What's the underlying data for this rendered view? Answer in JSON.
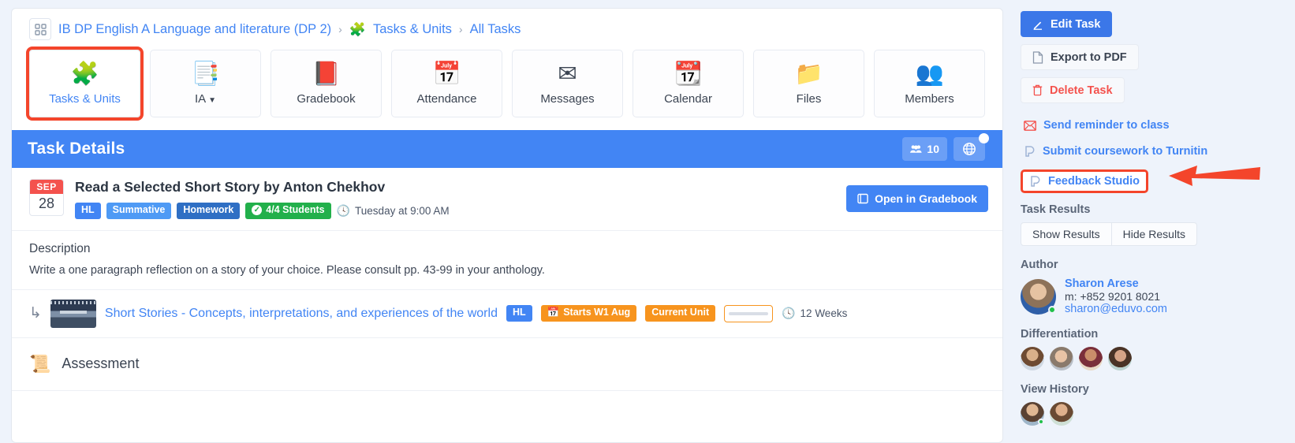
{
  "breadcrumb": {
    "grid_icon": "grid-icon",
    "course": "IB DP English A Language and literature (DP 2)",
    "sep1": "›",
    "section_icon": "puzzle-icon",
    "section": "Tasks & Units",
    "sep2": "›",
    "current": "All Tasks"
  },
  "tabs": [
    {
      "label": "Tasks & Units",
      "icon": "🧩",
      "icon_name": "puzzle-icon",
      "active": true
    },
    {
      "label": "IA",
      "icon": "📑",
      "icon_name": "documents-icon",
      "active": false,
      "caret": "▼"
    },
    {
      "label": "Gradebook",
      "icon": "📕",
      "icon_name": "gradebook-icon",
      "active": false
    },
    {
      "label": "Attendance",
      "icon": "📅",
      "icon_name": "attendance-icon",
      "active": false
    },
    {
      "label": "Messages",
      "icon": "✉",
      "icon_name": "envelope-icon",
      "active": false
    },
    {
      "label": "Calendar",
      "icon": "📆",
      "icon_name": "calendar-icon",
      "active": false
    },
    {
      "label": "Files",
      "icon": "📁",
      "icon_name": "folder-icon",
      "active": false
    },
    {
      "label": "Members",
      "icon": "👥",
      "icon_name": "members-icon",
      "active": false
    }
  ],
  "detail_bar": {
    "title": "Task Details",
    "members_count": "10",
    "members_icon": "people-icon",
    "globe_icon": "🌐"
  },
  "task": {
    "date_month": "SEP",
    "date_day": "28",
    "title": "Read a Selected Short Story by Anton Chekhov",
    "tags": [
      {
        "label": "HL",
        "style": "hl"
      },
      {
        "label": "Summative",
        "style": "summative"
      },
      {
        "label": "Homework",
        "style": "homework"
      },
      {
        "label": "4/4 Students",
        "style": "students",
        "check": "✓"
      }
    ],
    "due_icon": "clock-icon",
    "due": "Tuesday at 9:00 AM",
    "gradebook_button": "Open in Gradebook",
    "gradebook_icon": "book-icon"
  },
  "description": {
    "heading": "Description",
    "body": "Write a one paragraph reflection on a story of your choice. Please consult pp. 43-99 in your anthology."
  },
  "unit": {
    "arrow_icon": "↳",
    "thumb_icon": "unit-thumbnail",
    "link": "Short Stories - Concepts, interpretations, and experiences of the world",
    "tags": [
      {
        "label": "HL",
        "style": "hl"
      },
      {
        "label": "Starts W1 Aug",
        "style": "orange",
        "icon": "📅"
      },
      {
        "label": "Current Unit",
        "style": "orange"
      }
    ],
    "duration_icon": "clock-icon",
    "duration": "12 Weeks"
  },
  "assessment": {
    "icon": "📜",
    "title": "Assessment"
  },
  "sidebar": {
    "buttons": [
      {
        "label": "Edit Task",
        "style": "primary",
        "icon": "✎",
        "icon_name": "pencil-icon"
      },
      {
        "label": "Export to PDF",
        "style": "light",
        "icon": "📄",
        "icon_name": "pdf-icon"
      },
      {
        "label": "Delete Task",
        "style": "danger",
        "icon": "🗑",
        "icon_name": "trash-icon"
      }
    ],
    "links": [
      {
        "label": "Send reminder to class",
        "icon": "✉",
        "icon_name": "envelope-icon",
        "highlighted": false
      },
      {
        "label": "Submit coursework to Turnitin",
        "icon": "ʇ",
        "icon_name": "turnitin-icon",
        "highlighted": false
      },
      {
        "label": "Feedback Studio",
        "icon": "ʇ",
        "icon_name": "turnitin-icon",
        "highlighted": true
      }
    ],
    "task_results": {
      "title": "Task Results",
      "show": "Show Results",
      "hide": "Hide Results"
    },
    "author": {
      "title": "Author",
      "name": "Sharon Arese",
      "mobile": "m: +852 9201 8021",
      "email": "sharon@eduvo.com",
      "avatar_name": "sharon-avatar",
      "online": true
    },
    "differentiation": {
      "title": "Differentiation",
      "avatars": [
        "student-avatar-1",
        "student-avatar-2",
        "student-avatar-3",
        "student-avatar-4"
      ]
    },
    "view_history": {
      "title": "View History",
      "avatars": [
        "viewer-avatar-1",
        "viewer-avatar-2"
      ]
    }
  },
  "annotation": {
    "arrow": "red-arrow-pointing-left"
  }
}
